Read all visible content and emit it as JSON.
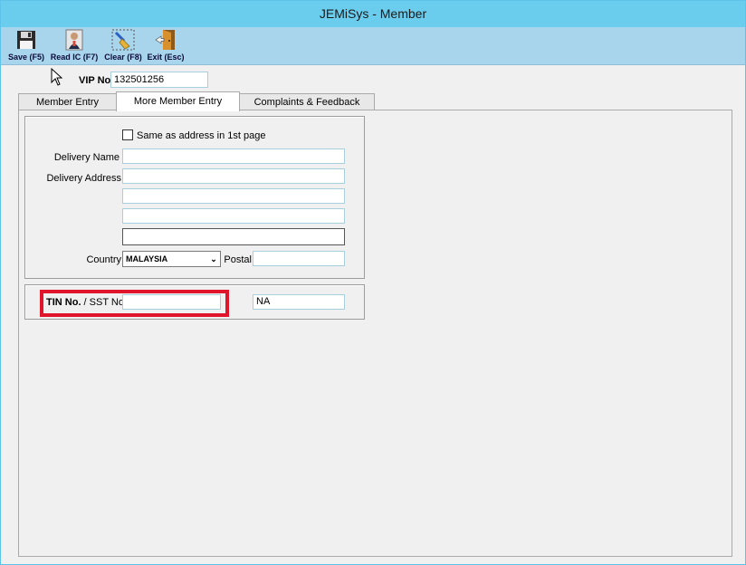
{
  "window": {
    "title": "JEMiSys - Member"
  },
  "toolbar": {
    "save_label": "Save (F5)",
    "read_ic_label": "Read IC (F7)",
    "clear_label": "Clear (F8)",
    "exit_label": "Exit (Esc)",
    "save_icon": "floppy-disk-icon",
    "read_ic_icon": "person-card-icon",
    "clear_icon": "broom-icon",
    "exit_icon": "exit-door-icon"
  },
  "vip": {
    "label": "VIP No.",
    "value": "132501256"
  },
  "tabs": [
    {
      "label": "Member Entry",
      "active": false
    },
    {
      "label": "More Member Entry",
      "active": true
    },
    {
      "label": "Complaints & Feedback",
      "active": false
    }
  ],
  "delivery": {
    "same_address_label": "Same as address in 1st page",
    "same_address_checked": false,
    "name_label": "Delivery Name",
    "name_value": "",
    "address_label": "Delivery Address",
    "address_lines": [
      "",
      "",
      "",
      ""
    ],
    "country_label": "Country",
    "country_value": "MALAYSIA",
    "postal_label": "Postal",
    "postal_value": ""
  },
  "tax": {
    "tin_label_bold": "TIN No.",
    "tin_label_rest": " / SST No.",
    "tin_value": "",
    "sst_value": "NA"
  },
  "colors": {
    "titlebar": "#6bcdee",
    "toolbar": "#a8d4ec",
    "highlight": "#e0142a"
  }
}
